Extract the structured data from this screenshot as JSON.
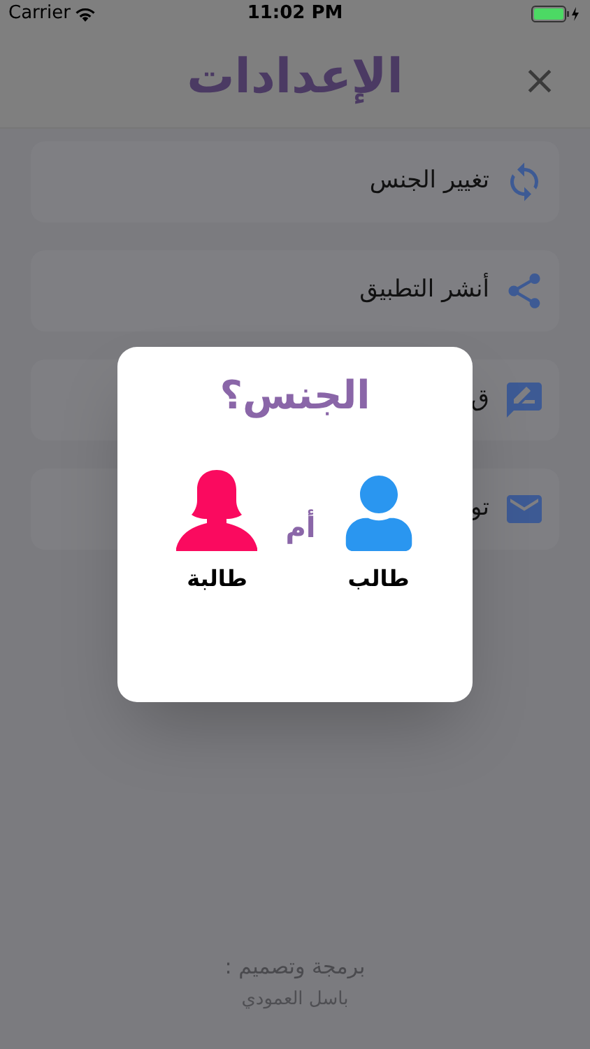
{
  "status_bar": {
    "carrier": "Carrier",
    "time": "11:02 PM"
  },
  "header": {
    "title": "الإعدادات"
  },
  "settings_items": [
    {
      "label": "تغيير الجنس"
    },
    {
      "label": "أنشر التطبيق"
    },
    {
      "label": "ق"
    },
    {
      "label": "تو"
    }
  ],
  "footer": {
    "credit_label": "برمجة وتصميم :",
    "author": "باسل العمودي"
  },
  "dialog": {
    "title": "الجنس؟",
    "options": [
      {
        "label": "طالب"
      },
      {
        "label": "طالبة"
      }
    ],
    "separator": "أم"
  }
}
